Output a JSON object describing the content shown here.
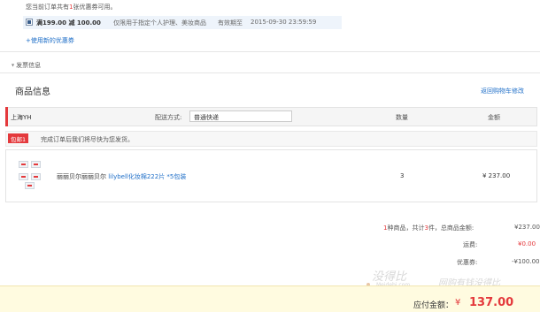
{
  "coupon": {
    "head_prefix": "您当前订单共有",
    "head_count": "1",
    "head_suffix": "张优惠券可用。",
    "amount": "满199.00 减 100.00",
    "scope": "仅限用于指定个人护理、美妆商品",
    "valid_label": "有效期至",
    "valid_date": "2015-09-30 23:59:59",
    "use_new": "+使用新的优惠券"
  },
  "invoice": {
    "label": "发票信息"
  },
  "goods": {
    "title": "商品信息",
    "back_cart": "返回购物车修改",
    "city": "上海YH",
    "ship_label": "配送方式:",
    "ship_method": "普通快递",
    "col_qty": "数量",
    "col_amount": "金额",
    "promo_badge": "包邮1",
    "promo_text": "完成订单后我们将尽快为您发货。",
    "item_name_prefix": "丽丽贝尔丽丽贝尔 ",
    "item_name_link": "lilybell化妆棉222片 *5包装",
    "item_qty": "3",
    "item_amount": "¥ 237.00"
  },
  "summary": {
    "kinds": "1",
    "kinds_label": "种商品，共计",
    "count": "3",
    "count_label": "件，总商品金额:",
    "total": "¥237.00",
    "ship_label": "运费:",
    "ship_value": "¥0.00",
    "coupon_label": "优惠券:",
    "coupon_value": "-¥100.00",
    "pay_label": "应付金额：",
    "pay_yen": "¥",
    "pay_value": "137.00"
  },
  "watermark": {
    "text": "没得比",
    "slogan": "网购有钱没得比",
    "domain": "Meidebi.com"
  }
}
